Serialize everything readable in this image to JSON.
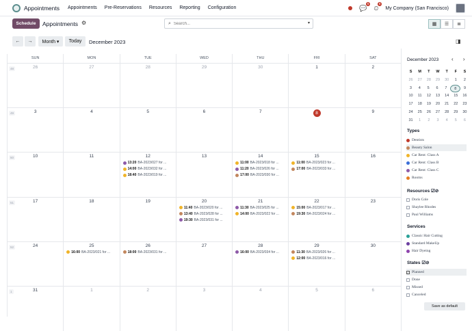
{
  "topbar": {
    "app_name": "Appointments",
    "menu": [
      "Appointments",
      "Pre-Reservations",
      "Resources",
      "Reporting",
      "Configuration"
    ],
    "chat_badge": "6",
    "activity_badge": "8",
    "company": "My Company (San Francisco)"
  },
  "control": {
    "schedule_label": "Schedule",
    "breadcrumb": "Appointments",
    "search_placeholder": "Search..."
  },
  "nav": {
    "prev": "←",
    "next": "→",
    "scale": "Month ▾",
    "today": "Today",
    "title": "December 2023"
  },
  "calendar": {
    "days_of_week": [
      "SUN",
      "MON",
      "TUE",
      "WED",
      "THU",
      "FRI",
      "SAT"
    ],
    "weeks": [
      {
        "num": "48",
        "days": [
          {
            "d": "26",
            "o": true
          },
          {
            "d": "27",
            "o": true
          },
          {
            "d": "28",
            "o": true
          },
          {
            "d": "29",
            "o": true
          },
          {
            "d": "30",
            "o": true
          },
          {
            "d": "1"
          },
          {
            "d": "2"
          }
        ]
      },
      {
        "num": "49",
        "days": [
          {
            "d": "3"
          },
          {
            "d": "4"
          },
          {
            "d": "5"
          },
          {
            "d": "6"
          },
          {
            "d": "7"
          },
          {
            "d": "8",
            "today": true
          },
          {
            "d": "9"
          }
        ]
      },
      {
        "num": "50",
        "days": [
          {
            "d": "10"
          },
          {
            "d": "11"
          },
          {
            "d": "12",
            "events": [
              {
                "t": "13:20",
                "n": "BA-2023/027 for ...",
                "c": "#8e5aa8"
              },
              {
                "t": "14:00",
                "n": "BA-2023/032 for ...",
                "c": "#f0b429"
              },
              {
                "t": "18:40",
                "n": "BA-2023/019 for ...",
                "c": "#f0b429"
              }
            ]
          },
          {
            "d": "13"
          },
          {
            "d": "14",
            "events": [
              {
                "t": "11:00",
                "n": "BA-2023/018 for ...",
                "c": "#f0b429"
              },
              {
                "t": "11:20",
                "n": "BA-2023/026 for ...",
                "c": "#8e5aa8"
              },
              {
                "t": "17:00",
                "n": "BA-2023/030 for ...",
                "c": "#c2875e"
              }
            ]
          },
          {
            "d": "15",
            "events": [
              {
                "t": "11:00",
                "n": "BA-2023/023 for ...",
                "c": "#f0b429"
              },
              {
                "t": "17:00",
                "n": "BA-2023/033 for ...",
                "c": "#c2875e"
              }
            ]
          },
          {
            "d": "16"
          }
        ]
      },
      {
        "num": "51",
        "days": [
          {
            "d": "17"
          },
          {
            "d": "18"
          },
          {
            "d": "19"
          },
          {
            "d": "20",
            "events": [
              {
                "t": "11:40",
                "n": "BA-2023/020 for ...",
                "c": "#f0b429"
              },
              {
                "t": "13:40",
                "n": "BA-2023/028 for ...",
                "c": "#c2875e"
              },
              {
                "t": "19:30",
                "n": "BA-2023/031 for ...",
                "c": "#8e5aa8"
              }
            ]
          },
          {
            "d": "21",
            "events": [
              {
                "t": "11:30",
                "n": "BA-2023/025 for ...",
                "c": "#8e5aa8"
              },
              {
                "t": "14:00",
                "n": "BA-2023/022 for ...",
                "c": "#f0b429"
              }
            ]
          },
          {
            "d": "22",
            "events": [
              {
                "t": "15:00",
                "n": "BA-2023/017 for ...",
                "c": "#f0b429"
              },
              {
                "t": "19:30",
                "n": "BA-2023/024 for ...",
                "c": "#c2875e"
              }
            ]
          },
          {
            "d": "23"
          }
        ]
      },
      {
        "num": "52",
        "days": [
          {
            "d": "24"
          },
          {
            "d": "25",
            "events": [
              {
                "t": "16:00",
                "n": "BA-2023/021 for ...",
                "c": "#f0b429"
              }
            ]
          },
          {
            "d": "26",
            "events": [
              {
                "t": "18:00",
                "n": "BA-2023/031 for ...",
                "c": "#c2875e"
              }
            ]
          },
          {
            "d": "27"
          },
          {
            "d": "28",
            "events": [
              {
                "t": "16:00",
                "n": "BA-2023/034 for ...",
                "c": "#8e5aa8"
              }
            ]
          },
          {
            "d": "29",
            "events": [
              {
                "t": "11:30",
                "n": "BA-2023/026 for ...",
                "c": "#c2875e"
              },
              {
                "t": "12:00",
                "n": "BA-2023/016 for ...",
                "c": "#f0b429"
              }
            ]
          },
          {
            "d": "30"
          }
        ]
      },
      {
        "num": "1",
        "days": [
          {
            "d": "31"
          },
          {
            "d": "1",
            "o": true
          },
          {
            "d": "2",
            "o": true
          },
          {
            "d": "3",
            "o": true
          },
          {
            "d": "4",
            "o": true
          },
          {
            "d": "5",
            "o": true
          },
          {
            "d": "6",
            "o": true
          }
        ]
      }
    ]
  },
  "mini": {
    "title": "December 2023",
    "nav": "‹ ›",
    "head": [
      "S",
      "M",
      "T",
      "W",
      "T",
      "F",
      "S"
    ],
    "rows": [
      [
        "26",
        "27",
        "28",
        "29",
        "30",
        "1",
        "2"
      ],
      [
        "3",
        "4",
        "5",
        "6",
        "7",
        "8",
        "9"
      ],
      [
        "10",
        "11",
        "12",
        "13",
        "14",
        "15",
        "16"
      ],
      [
        "17",
        "18",
        "19",
        "20",
        "21",
        "22",
        "23"
      ],
      [
        "24",
        "25",
        "26",
        "27",
        "28",
        "29",
        "30"
      ],
      [
        "31",
        "1",
        "2",
        "3",
        "4",
        "5",
        "6"
      ]
    ]
  },
  "filters": {
    "types_title": "Types",
    "types": [
      {
        "label": "Dentists",
        "color": "#c0392b"
      },
      {
        "label": "Beauty Salon",
        "color": "#c2875e"
      },
      {
        "label": "Car Rent: Class A",
        "color": "#f0b429"
      },
      {
        "label": "Car Rent: Class B",
        "color": "#3b6fd8"
      },
      {
        "label": "Car Rent: Class C",
        "color": "#8e5aa8"
      },
      {
        "label": "Rooms",
        "color": "#e67e22"
      }
    ],
    "resources_title": "Resources ☑⊘",
    "resources": [
      "Doris Cole",
      "Shaylee Rhodes",
      "Paul Williams"
    ],
    "services_title": "Services",
    "services": [
      {
        "label": "Classic Hair Cutting",
        "color": "#2aa198"
      },
      {
        "label": "Standard MakeUp",
        "color": "#6b3fa0"
      },
      {
        "label": "Hair Dyeing",
        "color": "#8e44ad"
      }
    ],
    "states_title": "States ☑⊘",
    "states": [
      "Planned",
      "Done",
      "Missed",
      "Canceled"
    ],
    "save_label": "Save as default"
  }
}
